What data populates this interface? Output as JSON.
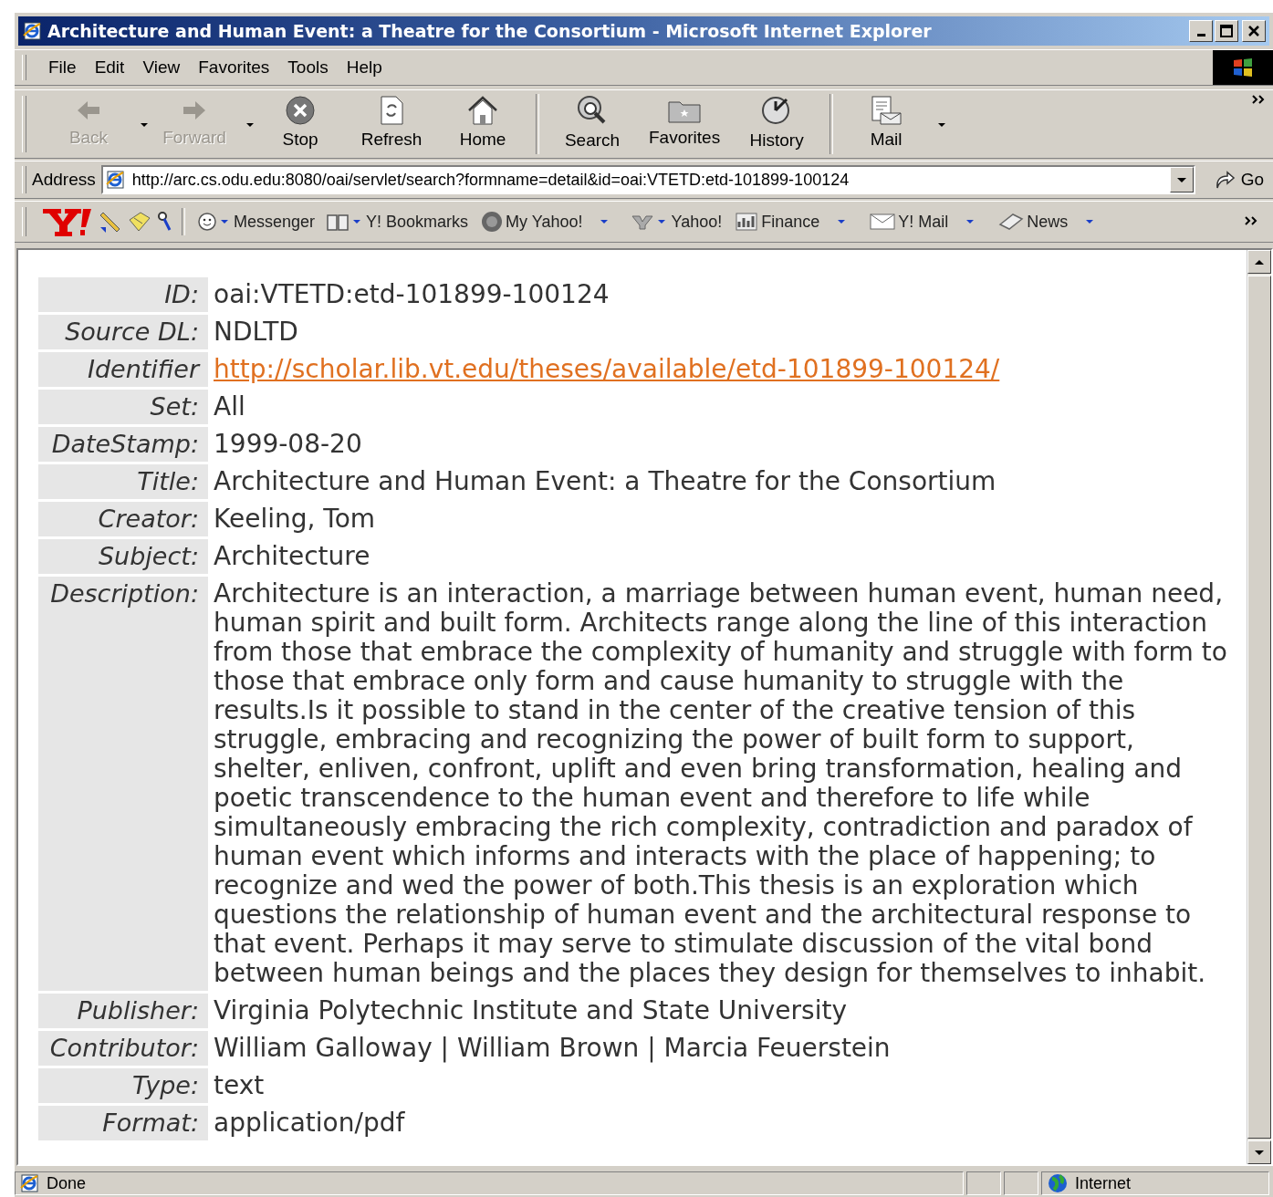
{
  "window": {
    "title": "Architecture and Human Event: a Theatre for the Consortium - Microsoft Internet Explorer"
  },
  "menu": [
    "File",
    "Edit",
    "View",
    "Favorites",
    "Tools",
    "Help"
  ],
  "toolbar": [
    {
      "label": "Back",
      "disabled": true,
      "dropdown": true
    },
    {
      "label": "Forward",
      "disabled": true,
      "dropdown": true
    },
    {
      "label": "Stop",
      "disabled": false,
      "dropdown": false
    },
    {
      "label": "Refresh",
      "disabled": false,
      "dropdown": false
    },
    {
      "label": "Home",
      "disabled": false,
      "dropdown": false
    },
    {
      "label": "Search",
      "disabled": false,
      "dropdown": false
    },
    {
      "label": "Favorites",
      "disabled": false,
      "dropdown": false
    },
    {
      "label": "History",
      "disabled": false,
      "dropdown": false
    },
    {
      "label": "Mail",
      "disabled": false,
      "dropdown": true
    }
  ],
  "address": {
    "label": "Address",
    "value": "http://arc.cs.odu.edu:8080/oai/servlet/search?formname=detail&id=oai:VTETD:etd-101899-100124",
    "go": "Go"
  },
  "links_bar": [
    {
      "label": "Messenger",
      "dropdown": true
    },
    {
      "label": "Y! Bookmarks",
      "dropdown": true
    },
    {
      "label": "My Yahoo!",
      "dropdown": true
    },
    {
      "label": "Yahoo!",
      "dropdown": true
    },
    {
      "label": "Finance",
      "dropdown": true
    },
    {
      "label": "Y! Mail",
      "dropdown": true
    },
    {
      "label": "News",
      "dropdown": true
    }
  ],
  "record": [
    {
      "label": "ID:",
      "value": "oai:VTETD:etd-101899-100124",
      "kind": "text"
    },
    {
      "label": "Source DL:",
      "value": "NDLTD",
      "kind": "text"
    },
    {
      "label": "Identifier",
      "value": "http://scholar.lib.vt.edu/theses/available/etd-101899-100124/",
      "kind": "link"
    },
    {
      "label": "Set:",
      "value": "All",
      "kind": "text"
    },
    {
      "label": "DateStamp:",
      "value": "1999-08-20",
      "kind": "text"
    },
    {
      "label": "Title:",
      "value": "Architecture and Human Event: a Theatre for the Consortium",
      "kind": "text"
    },
    {
      "label": "Creator:",
      "value": "Keeling, Tom",
      "kind": "text"
    },
    {
      "label": "Subject:",
      "value": "Architecture",
      "kind": "text"
    },
    {
      "label": "Description:",
      "value": "Architecture is an interaction, a marriage between human event, human need, human spirit and built form. Architects range along the line of this interaction from those that embrace the complexity of humanity and struggle with form to those that embrace only form and cause humanity to struggle with the results.Is it possible to stand in the center of the creative tension of this struggle, embracing and recognizing the power of built form to support, shelter, enliven, confront, uplift and even bring transformation, healing and poetic transcendence to the human event and therefore to life while simultaneously embracing the rich complexity, contradiction and paradox of human event which informs and interacts with the place of happening; to recognize and wed the power of both.This thesis is an exploration which questions the relationship of human event and the architectural response to that event. Perhaps it may serve to stimulate discussion of the vital bond between human beings and the places they design for themselves to inhabit.",
      "kind": "text"
    },
    {
      "label": "Publisher:",
      "value": "Virginia Polytechnic Institute and State University",
      "kind": "text"
    },
    {
      "label": "Contributor:",
      "value": "William Galloway | William Brown | Marcia Feuerstein",
      "kind": "text"
    },
    {
      "label": "Type:",
      "value": "text",
      "kind": "text"
    },
    {
      "label": "Format:",
      "value": "application/pdf",
      "kind": "text"
    }
  ],
  "status_bar": {
    "text": "Done",
    "zone": "Internet"
  }
}
